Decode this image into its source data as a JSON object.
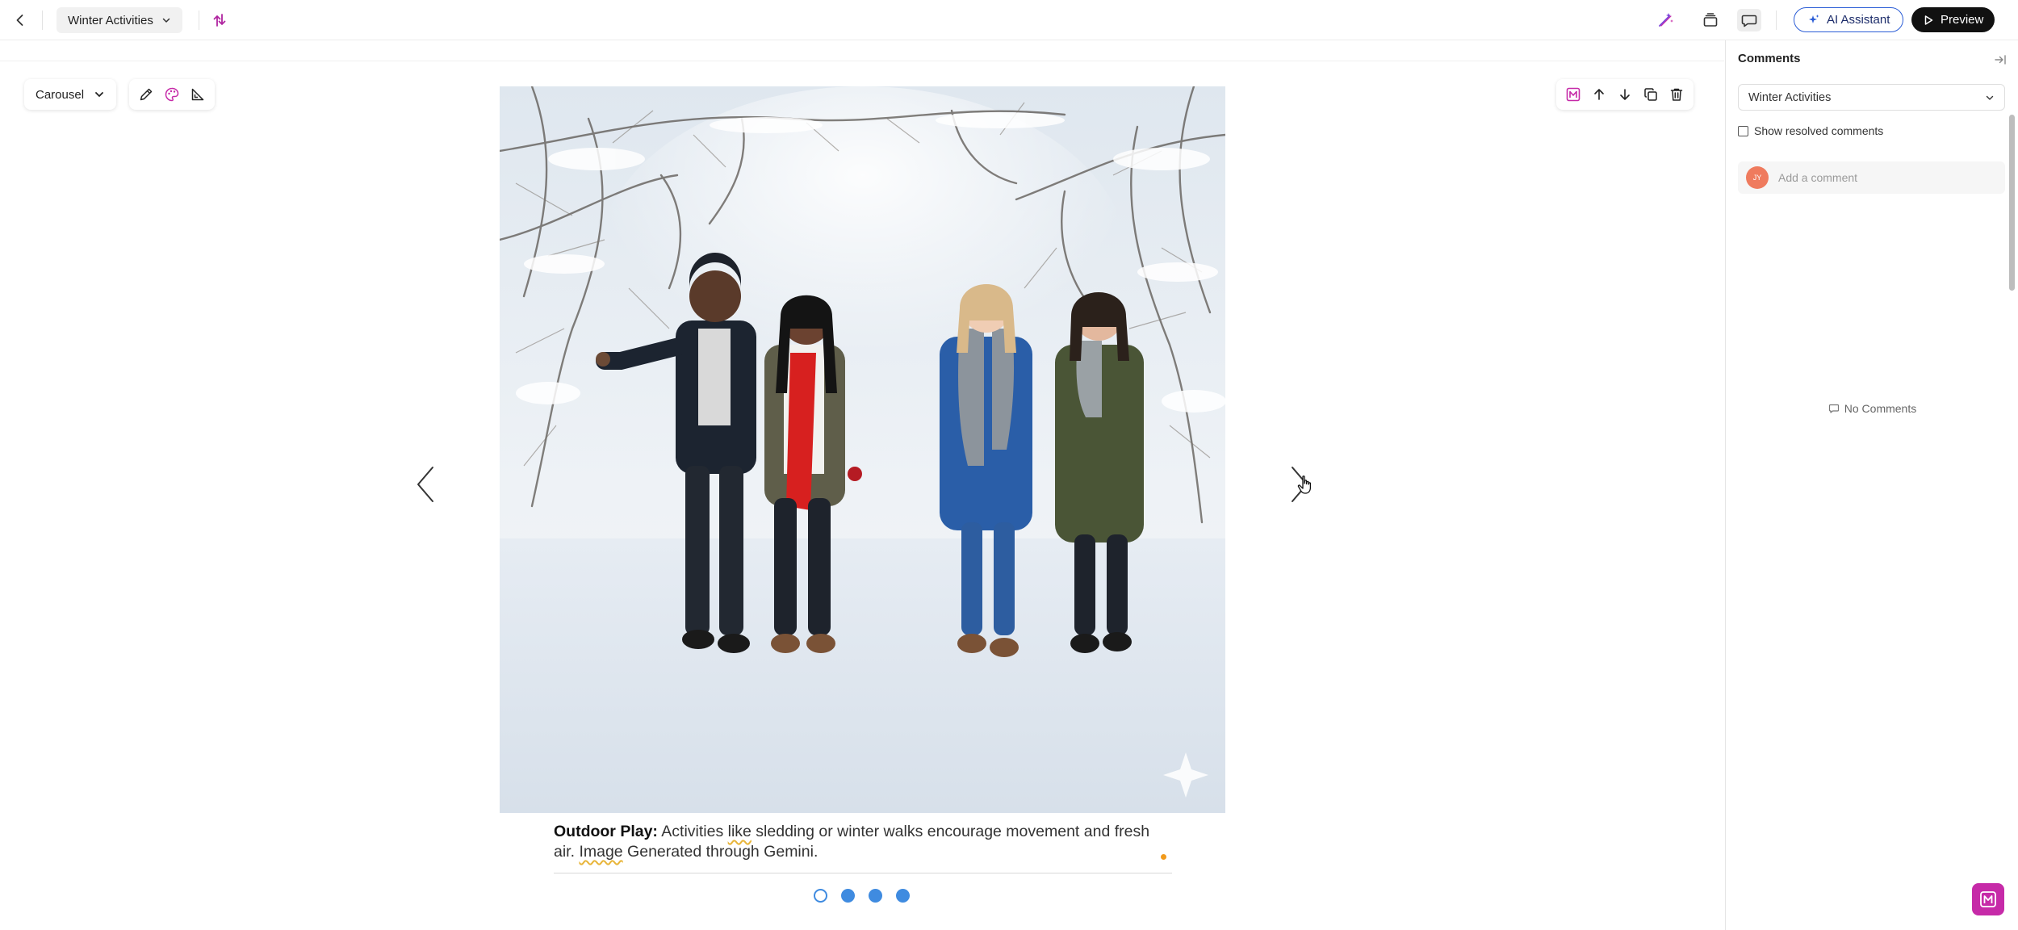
{
  "header": {
    "document_title": "Winter Activities",
    "ai_assistant_label": "AI Assistant",
    "preview_label": "Preview"
  },
  "editor": {
    "block_type": "Carousel",
    "carousel": {
      "caption_bold": "Outdoor Play:",
      "caption_part1": " Activities ",
      "caption_flag1": "like",
      "caption_part2": " sledding or winter walks encourage movement and fresh air. ",
      "caption_flag2": "Image",
      "caption_part3": " Generated through Gemini.",
      "slide_count": 4,
      "active_slide": 1
    }
  },
  "comments_panel": {
    "title": "Comments",
    "document_select": "Winter Activities",
    "show_resolved_label": "Show resolved comments",
    "avatar_initials": "JY",
    "comment_placeholder": "Add a comment",
    "empty_state": "No Comments"
  },
  "colors": {
    "accent_blue": "#3f8be0",
    "brand_magenta": "#c62aa8",
    "ai_border": "#2b5dd6",
    "avatar": "#ef7b5e"
  },
  "icons": {
    "back": "chevron-left-icon",
    "sort": "sort-arrows-icon",
    "magic": "magic-wand-icon",
    "stack": "layers-icon",
    "comments": "speech-bubble-icon",
    "edit": "pencil-icon",
    "palette": "palette-icon",
    "ruler": "set-square-icon"
  }
}
